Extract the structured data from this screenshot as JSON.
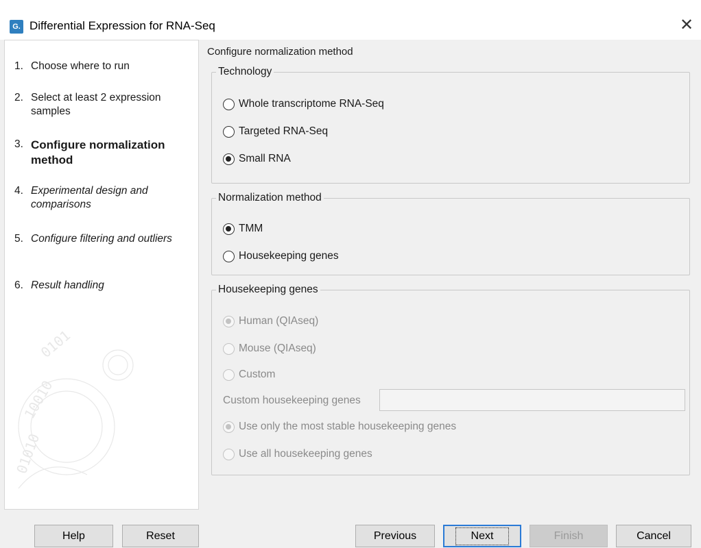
{
  "window": {
    "title": "Differential Expression for RNA-Seq",
    "app_icon_text": "G."
  },
  "sidebar": {
    "steps": [
      {
        "number": "1.",
        "label": "Choose where to run",
        "state": "done"
      },
      {
        "number": "2.",
        "label": "Select at least 2 expression samples",
        "state": "done"
      },
      {
        "number": "3.",
        "label": "Configure normalization method",
        "state": "current"
      },
      {
        "number": "4.",
        "label": "Experimental design and comparisons",
        "state": "future"
      },
      {
        "number": "5.",
        "label": "Configure filtering and outliers",
        "state": "future"
      },
      {
        "number": "6.",
        "label": "Result handling",
        "state": "future"
      }
    ]
  },
  "main": {
    "heading": "Configure normalization method",
    "technology": {
      "legend": "Technology",
      "options": [
        {
          "label": "Whole transcriptome RNA-Seq",
          "checked": false
        },
        {
          "label": "Targeted RNA-Seq",
          "checked": false
        },
        {
          "label": "Small RNA",
          "checked": true
        }
      ]
    },
    "normalization": {
      "legend": "Normalization method",
      "options": [
        {
          "label": "TMM",
          "checked": true
        },
        {
          "label": "Housekeeping genes",
          "checked": false
        }
      ]
    },
    "housekeeping": {
      "legend": "Housekeeping genes",
      "enabled": false,
      "gene_sets": [
        {
          "label": "Human (QIAseq)",
          "checked": true
        },
        {
          "label": "Mouse (QIAseq)",
          "checked": false
        },
        {
          "label": "Custom",
          "checked": false
        }
      ],
      "custom_label": "Custom housekeeping genes",
      "custom_value": "",
      "modes": [
        {
          "label": "Use only the most stable housekeeping genes",
          "checked": true
        },
        {
          "label": "Use all housekeeping genes",
          "checked": false
        }
      ]
    }
  },
  "footer": {
    "help": "Help",
    "reset": "Reset",
    "previous": "Previous",
    "next": "Next",
    "finish": "Finish",
    "cancel": "Cancel"
  }
}
